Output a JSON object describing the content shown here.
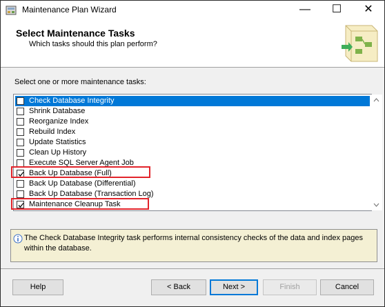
{
  "window": {
    "title": "Maintenance Plan Wizard",
    "controls": {
      "minimize": "—",
      "maximize": "☐",
      "close": "✕"
    }
  },
  "header": {
    "title": "Select Maintenance Tasks",
    "subtitle": "Which tasks should this plan perform?"
  },
  "tasks": {
    "label": "Select one or more maintenance tasks:",
    "items": [
      {
        "label": "Check Database Integrity",
        "checked": false,
        "selected": true
      },
      {
        "label": "Shrink Database",
        "checked": false
      },
      {
        "label": "Reorganize Index",
        "checked": false
      },
      {
        "label": "Rebuild Index",
        "checked": false
      },
      {
        "label": "Update Statistics",
        "checked": false
      },
      {
        "label": "Clean Up History",
        "checked": false
      },
      {
        "label": "Execute SQL Server Agent Job",
        "checked": false
      },
      {
        "label": "Back Up Database (Full)",
        "checked": true,
        "highlighted": true
      },
      {
        "label": "Back Up Database (Differential)",
        "checked": false
      },
      {
        "label": "Back Up Database (Transaction Log)",
        "checked": false
      },
      {
        "label": "Maintenance Cleanup Task",
        "checked": true,
        "highlighted": true
      }
    ]
  },
  "info": {
    "text": "The Check Database Integrity task performs internal consistency checks of the data and index pages within the database."
  },
  "buttons": {
    "help": "Help",
    "back": "< Back",
    "next": "Next >",
    "finish": "Finish",
    "cancel": "Cancel"
  },
  "colors": {
    "selection": "#0078d7",
    "highlight_box": "#e2232a",
    "info_background": "#f4f0d4"
  }
}
